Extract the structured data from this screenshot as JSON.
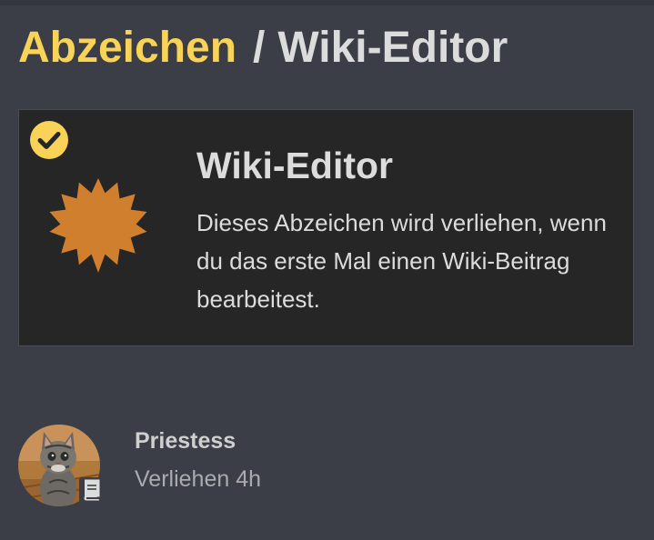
{
  "breadcrumb": {
    "parent": "Abzeichen",
    "separator": "/",
    "current": "Wiki-Editor"
  },
  "badge": {
    "title": "Wiki-Editor",
    "description": "Dieses Abzeichen wird verliehen, wenn du das erste Mal einen Wiki-Beitrag bearbeitest.",
    "icon": "bronze-badge-icon",
    "earned_icon": "check-circle-icon",
    "colors": {
      "badge": "#d07f2e",
      "check": "#f8d357",
      "card_bg": "#262626"
    }
  },
  "grant": {
    "username": "Priestess",
    "granted_text": "Verliehen 4h",
    "avatar": "cat-avatar",
    "user_badge_icon": "book-icon"
  },
  "colors": {
    "background": "#3b3e46",
    "accent": "#f8d357",
    "text": "#dcdcdc",
    "muted": "#a9abaf"
  }
}
